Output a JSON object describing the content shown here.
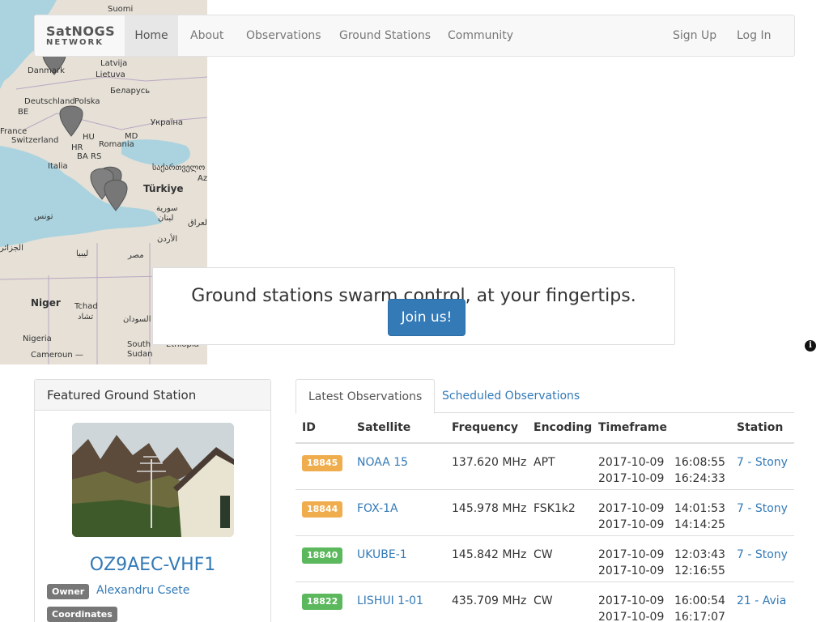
{
  "map": {
    "labels": [
      "Suomi",
      "Danmark",
      "Latvija",
      "Lietuva",
      "Беларусь",
      "Deutschland",
      "Polska",
      "BE",
      "France",
      "Switzerland",
      "MD",
      "Україна",
      "HU",
      "HR",
      "BA",
      "RS",
      "Romania",
      "Italia",
      "Türkiye",
      "საქართველო",
      "Az",
      "تونس",
      "سورية",
      "لبنان",
      "العراق",
      "الأردن",
      "الجزائر",
      "ليبيا",
      "مصر",
      "Niger",
      "Tchad",
      "تشاد",
      "Nigeria",
      "السودان",
      "South Sudan",
      "Cameroun —",
      "Ethiopia"
    ]
  },
  "navbar": {
    "brand_line1": "SatNOGS",
    "brand_line2": "NETWORK",
    "items": [
      "Home",
      "About",
      "Observations",
      "Ground Stations",
      "Community"
    ],
    "right_items": [
      "Sign Up",
      "Log In"
    ]
  },
  "hero": {
    "tagline": "Ground stations swarm control, at your fingertips.",
    "button": "Join us!"
  },
  "info_icon": "i",
  "featured": {
    "title": "Featured Ground Station",
    "station_name": "OZ9AEC-VHF1",
    "owner_label": "Owner",
    "owner_name": "Alexandru Csete",
    "coordinates_label": "Coordinates"
  },
  "tabs": [
    "Latest Observations",
    "Scheduled Observations"
  ],
  "table": {
    "headers": [
      "ID",
      "Satellite",
      "Frequency",
      "Encoding",
      "Timeframe",
      "Station"
    ],
    "rows": [
      {
        "id": "18845",
        "status_color": "#f0ad4e",
        "satellite": "NOAA 15",
        "frequency": "137.620 MHz",
        "encoding": "APT",
        "start_date": "2017-10-09",
        "start_time": "16:08:55",
        "end_date": "2017-10-09",
        "end_time": "16:24:33",
        "station": "7 - Stony"
      },
      {
        "id": "18844",
        "status_color": "#f0ad4e",
        "satellite": "FOX-1A",
        "frequency": "145.978 MHz",
        "encoding": "FSK1k2",
        "start_date": "2017-10-09",
        "start_time": "14:01:53",
        "end_date": "2017-10-09",
        "end_time": "14:14:25",
        "station": "7 - Stony"
      },
      {
        "id": "18840",
        "status_color": "#5cb85c",
        "satellite": "UKUBE-1",
        "frequency": "145.842 MHz",
        "encoding": "CW",
        "start_date": "2017-10-09",
        "start_time": "12:03:43",
        "end_date": "2017-10-09",
        "end_time": "12:16:55",
        "station": "7 - Stony"
      },
      {
        "id": "18822",
        "status_color": "#5cb85c",
        "satellite": "LISHUI 1-01",
        "frequency": "435.709 MHz",
        "encoding": "CW",
        "start_date": "2017-10-09",
        "start_time": "16:00:54",
        "end_date": "2017-10-09",
        "end_time": "16:17:07",
        "station": "21 - Avia"
      }
    ]
  }
}
